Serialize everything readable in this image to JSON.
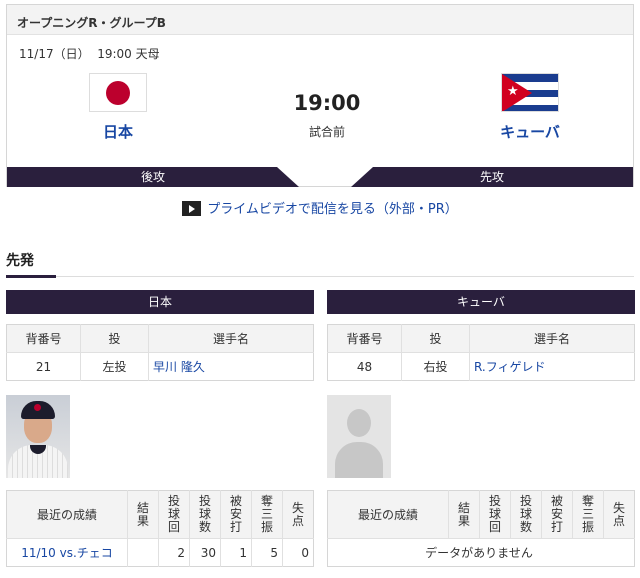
{
  "header": {
    "round": "オープニングR・グループB",
    "date": "11/17（日）",
    "time_venue": "19:00 天母"
  },
  "match": {
    "home": {
      "name": "日本",
      "flag": "japan-flag",
      "side": "後攻"
    },
    "away": {
      "name": "キューバ",
      "flag": "cuba-flag",
      "side": "先攻"
    },
    "time": "19:00",
    "status": "試合前"
  },
  "prime_link": "プライムビデオで配信を見る（外部・PR）",
  "starters": {
    "title": "先発",
    "columns": {
      "number": "背番号",
      "throws": "投",
      "player": "選手名"
    },
    "stats_headers": [
      "最近の成績",
      "結果",
      "投球回",
      "投球数",
      "被安打",
      "奪三振",
      "失点"
    ],
    "home": {
      "team": "日本",
      "number": "21",
      "throws": "左投",
      "player": "早川 隆久",
      "recent": [
        {
          "game": "11/10 vs.チェコ",
          "result": "",
          "innings": "2",
          "pitches": "30",
          "hits": "1",
          "strikeouts": "5",
          "runs": "0"
        }
      ]
    },
    "away": {
      "team": "キューバ",
      "number": "48",
      "throws": "右投",
      "player": "R.フィゲレド",
      "no_data": "データがありません"
    }
  },
  "colors": {
    "navy": "#2a1f3d",
    "link": "#1847a3",
    "jp_red": "#bc002d",
    "cuba_blue": "#1a3c8f",
    "cuba_red": "#d1001f"
  }
}
